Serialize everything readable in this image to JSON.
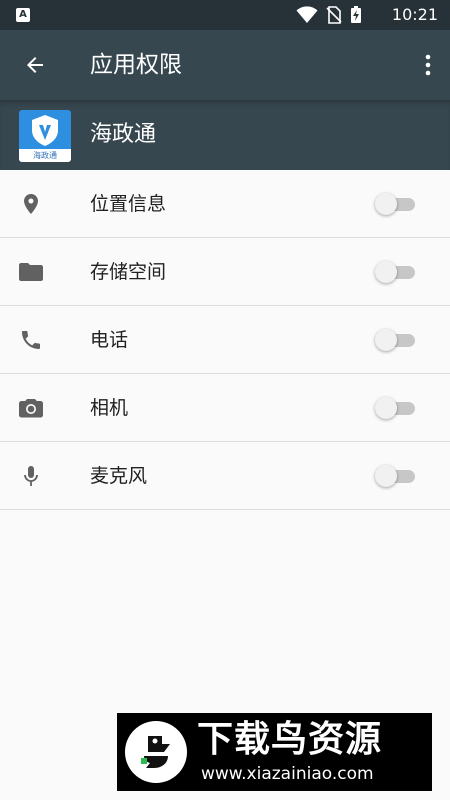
{
  "status_bar": {
    "notification_badge": "A",
    "time": "10:21",
    "icons": [
      "wifi-icon",
      "no-sim-icon",
      "battery-charging-icon"
    ]
  },
  "app_bar": {
    "title": "应用权限",
    "back_icon": "arrow-left-icon",
    "overflow_icon": "more-vert-icon"
  },
  "app": {
    "name": "海政通",
    "logo_caption": "海政通"
  },
  "permissions": [
    {
      "label": "位置信息",
      "icon": "location-pin-icon",
      "enabled": false
    },
    {
      "label": "存储空间",
      "icon": "folder-icon",
      "enabled": false
    },
    {
      "label": "电话",
      "icon": "phone-icon",
      "enabled": false
    },
    {
      "label": "相机",
      "icon": "camera-icon",
      "enabled": false
    },
    {
      "label": "麦克风",
      "icon": "microphone-icon",
      "enabled": false
    }
  ],
  "watermark": {
    "title": "下载鸟资源",
    "url": "www.xiazainiao.com"
  },
  "colors": {
    "app_bar": "#37474f",
    "status_bar": "#263238",
    "background": "#fafafa",
    "icon": "#616161",
    "toggle_track_off": "#c7c7c7",
    "toggle_thumb_off": "#f1f1f1",
    "divider": "#dcdcdc"
  }
}
